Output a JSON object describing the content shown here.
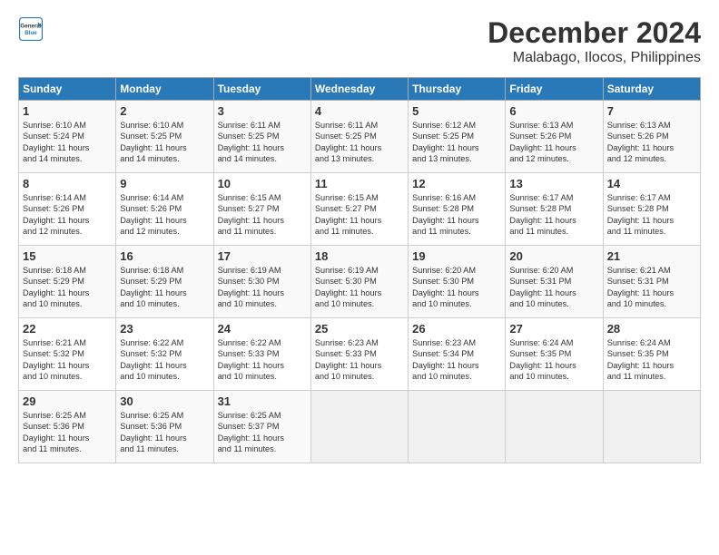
{
  "logo": {
    "line1": "General",
    "line2": "Blue"
  },
  "title": "December 2024",
  "location": "Malabago, Ilocos, Philippines",
  "weekdays": [
    "Sunday",
    "Monday",
    "Tuesday",
    "Wednesday",
    "Thursday",
    "Friday",
    "Saturday"
  ],
  "weeks": [
    [
      {
        "day": "1",
        "rise": "6:10 AM",
        "set": "5:24 PM",
        "daylight": "11 hours and 14 minutes."
      },
      {
        "day": "2",
        "rise": "6:10 AM",
        "set": "5:25 PM",
        "daylight": "11 hours and 14 minutes."
      },
      {
        "day": "3",
        "rise": "6:11 AM",
        "set": "5:25 PM",
        "daylight": "11 hours and 14 minutes."
      },
      {
        "day": "4",
        "rise": "6:11 AM",
        "set": "5:25 PM",
        "daylight": "11 hours and 13 minutes."
      },
      {
        "day": "5",
        "rise": "6:12 AM",
        "set": "5:25 PM",
        "daylight": "11 hours and 13 minutes."
      },
      {
        "day": "6",
        "rise": "6:13 AM",
        "set": "5:26 PM",
        "daylight": "11 hours and 12 minutes."
      },
      {
        "day": "7",
        "rise": "6:13 AM",
        "set": "5:26 PM",
        "daylight": "11 hours and 12 minutes."
      }
    ],
    [
      {
        "day": "8",
        "rise": "6:14 AM",
        "set": "5:26 PM",
        "daylight": "11 hours and 12 minutes."
      },
      {
        "day": "9",
        "rise": "6:14 AM",
        "set": "5:26 PM",
        "daylight": "11 hours and 12 minutes."
      },
      {
        "day": "10",
        "rise": "6:15 AM",
        "set": "5:27 PM",
        "daylight": "11 hours and 11 minutes."
      },
      {
        "day": "11",
        "rise": "6:15 AM",
        "set": "5:27 PM",
        "daylight": "11 hours and 11 minutes."
      },
      {
        "day": "12",
        "rise": "6:16 AM",
        "set": "5:28 PM",
        "daylight": "11 hours and 11 minutes."
      },
      {
        "day": "13",
        "rise": "6:17 AM",
        "set": "5:28 PM",
        "daylight": "11 hours and 11 minutes."
      },
      {
        "day": "14",
        "rise": "6:17 AM",
        "set": "5:28 PM",
        "daylight": "11 hours and 11 minutes."
      }
    ],
    [
      {
        "day": "15",
        "rise": "6:18 AM",
        "set": "5:29 PM",
        "daylight": "11 hours and 10 minutes."
      },
      {
        "day": "16",
        "rise": "6:18 AM",
        "set": "5:29 PM",
        "daylight": "11 hours and 10 minutes."
      },
      {
        "day": "17",
        "rise": "6:19 AM",
        "set": "5:30 PM",
        "daylight": "11 hours and 10 minutes."
      },
      {
        "day": "18",
        "rise": "6:19 AM",
        "set": "5:30 PM",
        "daylight": "11 hours and 10 minutes."
      },
      {
        "day": "19",
        "rise": "6:20 AM",
        "set": "5:30 PM",
        "daylight": "11 hours and 10 minutes."
      },
      {
        "day": "20",
        "rise": "6:20 AM",
        "set": "5:31 PM",
        "daylight": "11 hours and 10 minutes."
      },
      {
        "day": "21",
        "rise": "6:21 AM",
        "set": "5:31 PM",
        "daylight": "11 hours and 10 minutes."
      }
    ],
    [
      {
        "day": "22",
        "rise": "6:21 AM",
        "set": "5:32 PM",
        "daylight": "11 hours and 10 minutes."
      },
      {
        "day": "23",
        "rise": "6:22 AM",
        "set": "5:32 PM",
        "daylight": "11 hours and 10 minutes."
      },
      {
        "day": "24",
        "rise": "6:22 AM",
        "set": "5:33 PM",
        "daylight": "11 hours and 10 minutes."
      },
      {
        "day": "25",
        "rise": "6:23 AM",
        "set": "5:33 PM",
        "daylight": "11 hours and 10 minutes."
      },
      {
        "day": "26",
        "rise": "6:23 AM",
        "set": "5:34 PM",
        "daylight": "11 hours and 10 minutes."
      },
      {
        "day": "27",
        "rise": "6:24 AM",
        "set": "5:35 PM",
        "daylight": "11 hours and 10 minutes."
      },
      {
        "day": "28",
        "rise": "6:24 AM",
        "set": "5:35 PM",
        "daylight": "11 hours and 11 minutes."
      }
    ],
    [
      {
        "day": "29",
        "rise": "6:25 AM",
        "set": "5:36 PM",
        "daylight": "11 hours and 11 minutes."
      },
      {
        "day": "30",
        "rise": "6:25 AM",
        "set": "5:36 PM",
        "daylight": "11 hours and 11 minutes."
      },
      {
        "day": "31",
        "rise": "6:25 AM",
        "set": "5:37 PM",
        "daylight": "11 hours and 11 minutes."
      },
      null,
      null,
      null,
      null
    ]
  ]
}
